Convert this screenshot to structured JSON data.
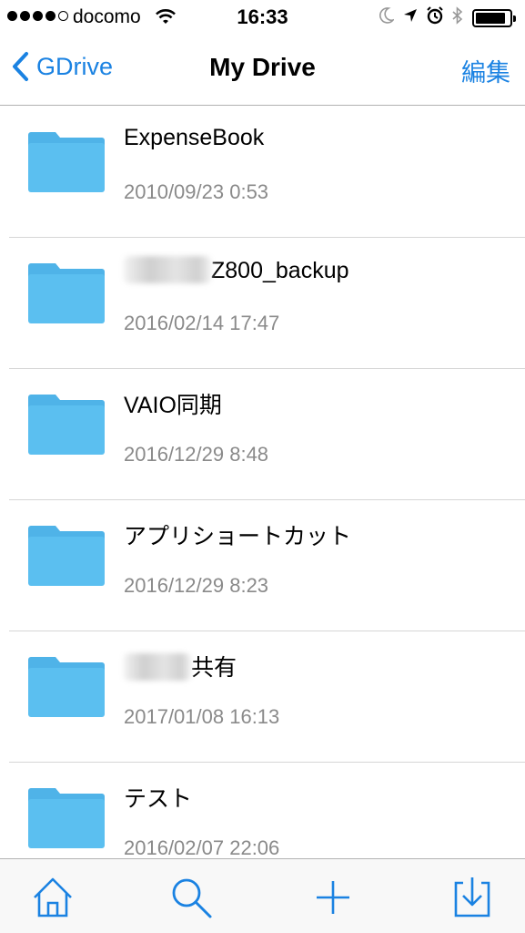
{
  "status_bar": {
    "carrier": "docomo",
    "time": "16:33",
    "signal_bars_filled": 4,
    "signal_bars_total": 5,
    "battery_level": 0.9,
    "icons": [
      "wifi-icon",
      "moon-icon",
      "location-arrow-icon",
      "alarm-icon",
      "bluetooth-icon",
      "battery-icon"
    ]
  },
  "nav": {
    "back_label": "GDrive",
    "title": "My Drive",
    "edit_label": "編集"
  },
  "files": [
    {
      "name": "ExpenseBook",
      "date": "2010/09/23 0:53"
    },
    {
      "name": "Z800_backup",
      "date": "2016/02/14 17:47",
      "redacted_prefix": true
    },
    {
      "name": "VAIO同期",
      "date": "2016/12/29 8:48"
    },
    {
      "name": "アプリショートカット",
      "date": "2016/12/29 8:23"
    },
    {
      "name": "共有",
      "date": "2017/01/08 16:13",
      "redacted_prefix": true
    },
    {
      "name": "テスト",
      "date": "2016/02/07 22:06"
    }
  ],
  "tab_bar": {
    "items": [
      "home-icon",
      "search-icon",
      "add-icon",
      "download-icon"
    ]
  },
  "colors": {
    "accent": "#1a82e2",
    "folder": "#5bbff0",
    "folder_tab": "#4fb3e8",
    "date_text": "#8a8a8a",
    "separator": "#d6d6d6"
  }
}
